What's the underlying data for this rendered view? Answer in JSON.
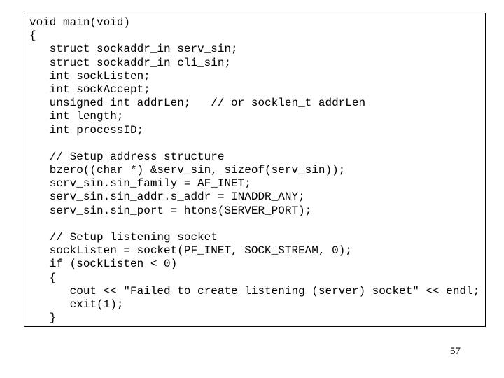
{
  "slide": {
    "page_number": "57",
    "code_lines": [
      "void main(void)",
      "{",
      "   struct sockaddr_in serv_sin;",
      "   struct sockaddr_in cli_sin;",
      "   int sockListen;",
      "   int sockAccept;",
      "   unsigned int addrLen;   // or socklen_t addrLen",
      "   int length;",
      "   int processID;",
      "",
      "   // Setup address structure",
      "   bzero((char *) &serv_sin, sizeof(serv_sin));",
      "   serv_sin.sin_family = AF_INET;",
      "   serv_sin.sin_addr.s_addr = INADDR_ANY;",
      "   serv_sin.sin_port = htons(SERVER_PORT);",
      "",
      "   // Setup listening socket",
      "   sockListen = socket(PF_INET, SOCK_STREAM, 0);",
      "   if (sockListen < 0)",
      "   {",
      "      cout << \"Failed to create listening (server) socket\" << endl;",
      "      exit(1);",
      "   }"
    ]
  }
}
